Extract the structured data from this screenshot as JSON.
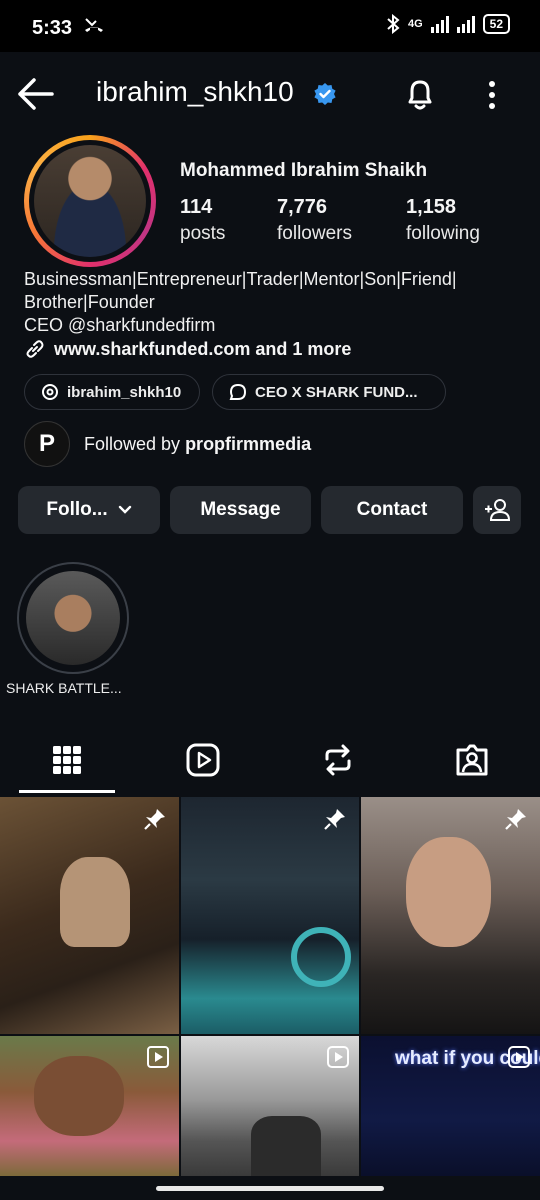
{
  "status_bar": {
    "time": "5:33",
    "network": "4G",
    "battery": "52"
  },
  "header": {
    "username": "ibrahim_shkh10"
  },
  "profile": {
    "full_name": "Mohammed Ibrahim Shaikh",
    "stats": [
      {
        "num": "114",
        "label": "posts"
      },
      {
        "num": "7,776",
        "label": "followers"
      },
      {
        "num": "1,158",
        "label": "following"
      }
    ],
    "bio_line1": "Businessman|Entrepreneur|Trader|Mentor|Son|Friend|",
    "bio_line2": "Brother|Founder",
    "bio_line3": "CEO @sharkfundedfirm",
    "link_text": "www.sharkfunded.com and 1 more",
    "chips": [
      "ibrahim_shkh10",
      "CEO X SHARK FUND..."
    ],
    "followed_by_prefix": "Followed by ",
    "followed_by_name": "propfirmmedia",
    "followed_logo": "P"
  },
  "actions": {
    "follow": "Follo...",
    "message": "Message",
    "contact": "Contact"
  },
  "highlights": [
    {
      "label": "SHARK BATTLE..."
    }
  ],
  "tabs": [
    "grid-icon",
    "reels-icon",
    "reposts-icon",
    "tagged-icon"
  ],
  "grid": {
    "posts": [
      {
        "type": "pinned"
      },
      {
        "type": "pinned"
      },
      {
        "type": "pinned"
      },
      {
        "type": "carousel"
      },
      {
        "type": "reel"
      },
      {
        "type": "reel",
        "overlay_text": "what if you could trade today"
      }
    ]
  },
  "colors": {
    "background": "#0c0f14",
    "button": "#25292f",
    "verified": "#3897f0"
  }
}
